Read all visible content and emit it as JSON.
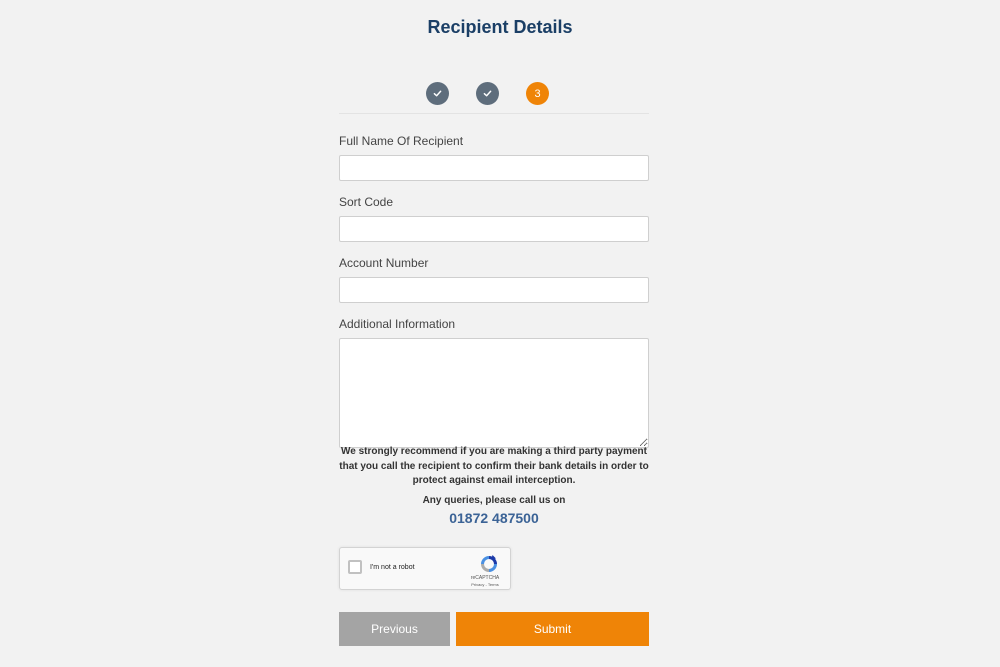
{
  "page": {
    "title": "Recipient Details"
  },
  "stepper": {
    "steps": [
      {
        "state": "done",
        "icon": "check-icon"
      },
      {
        "state": "done",
        "icon": "check-icon"
      },
      {
        "state": "active",
        "label": "3"
      }
    ],
    "done_color": "#5e6d7c",
    "active_color": "#ef8407"
  },
  "form": {
    "full_name": {
      "label": "Full Name Of Recipient",
      "value": ""
    },
    "sort_code": {
      "label": "Sort Code",
      "value": ""
    },
    "account_number": {
      "label": "Account Number",
      "value": ""
    },
    "additional_info": {
      "label": "Additional Information",
      "value": ""
    }
  },
  "notice": {
    "text": "We strongly recommend if you are making a third party payment that you call the recipient to confirm their bank details in order to protect against email interception.",
    "queries_text": "Any queries, please call us on",
    "phone": "01872 487500"
  },
  "recaptcha": {
    "label": "I'm not a robot",
    "brand": "reCAPTCHA",
    "links": "Privacy - Terms",
    "checked": false
  },
  "buttons": {
    "previous_label": "Previous",
    "submit_label": "Submit"
  },
  "colors": {
    "title": "#1b3f66",
    "accent": "#ef8407",
    "phone": "#3b6396",
    "secondary_button": "#a4a4a4"
  }
}
